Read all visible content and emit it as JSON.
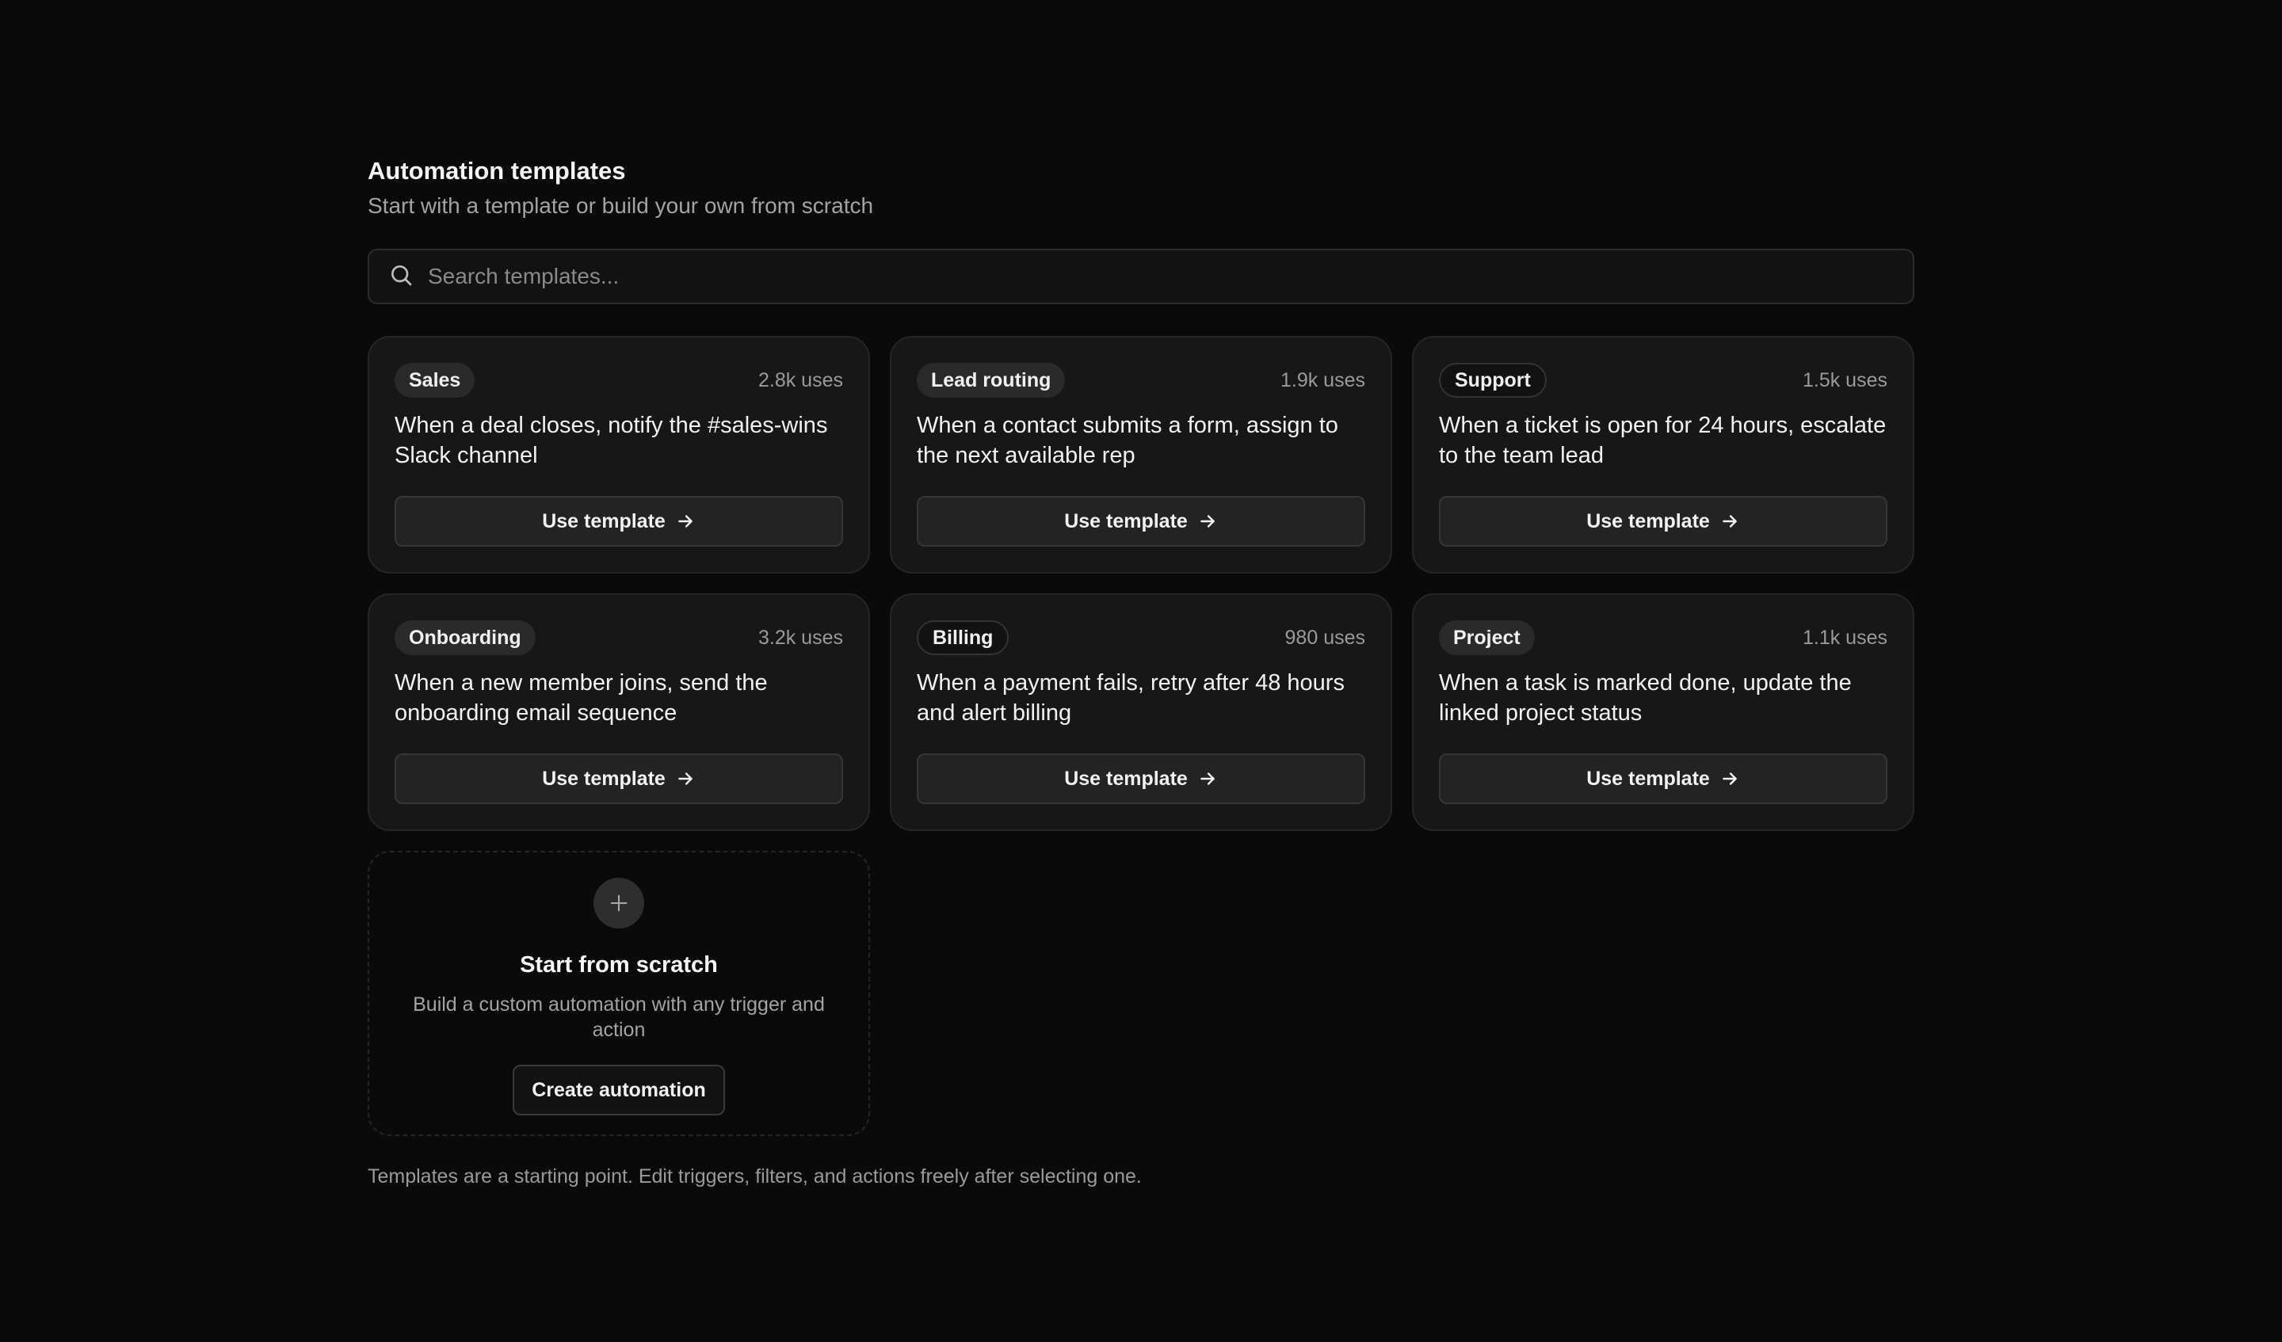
{
  "header": {
    "title": "Automation templates",
    "subtitle": "Start with a template or build your own from scratch"
  },
  "search": {
    "placeholder": "Search templates...",
    "icon": "search-icon"
  },
  "templates": [
    {
      "tag": "Sales",
      "uses": "2.8k uses",
      "description": "When a deal closes, notify the #sales-wins Slack channel",
      "button": "Use template"
    },
    {
      "tag": "Lead routing",
      "uses": "1.9k uses",
      "description": "When a contact submits a form, assign to the next available rep",
      "button": "Use template"
    },
    {
      "tag": "Support",
      "uses": "1.5k uses",
      "description": "When a ticket is open for 24 hours, escalate to the team lead",
      "button": "Use template"
    },
    {
      "tag": "Onboarding",
      "uses": "3.2k uses",
      "description": "When a new member joins, send the onboarding email sequence",
      "button": "Use template"
    },
    {
      "tag": "Billing",
      "uses": "980 uses",
      "description": "When a payment fails, retry after 48 hours and alert billing",
      "button": "Use template"
    },
    {
      "tag": "Project",
      "uses": "1.1k uses",
      "description": "When a task is marked done, update the linked project status",
      "button": "Use template"
    }
  ],
  "scratch": {
    "title": "Start from scratch",
    "description": "Build a custom automation with any trigger and action",
    "button": "Create automation",
    "icon": "plus-icon"
  },
  "footnote": "Templates are a starting point. Edit triggers, filters, and actions freely after selecting one.",
  "colors": {
    "background": "#0a0a0a",
    "card": "#171717",
    "border": "#262626",
    "muted_text": "#a3a3a3"
  }
}
